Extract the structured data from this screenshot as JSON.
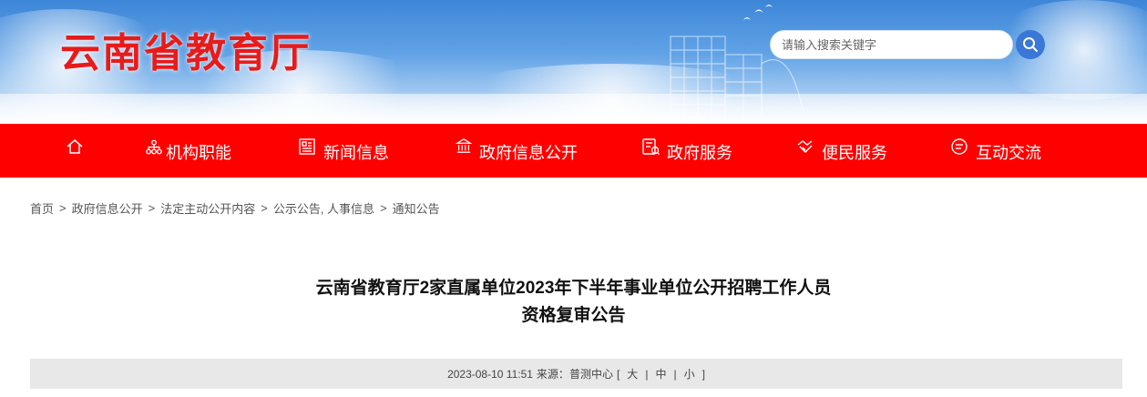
{
  "header": {
    "site_title": "云南省教育厅",
    "search_placeholder": "请输入搜索关键字",
    "search_icon": "search-icon"
  },
  "nav": {
    "items": [
      {
        "label": "",
        "icon": "home-icon"
      },
      {
        "label": "机构职能",
        "icon": "org-chart-icon"
      },
      {
        "label": "新闻信息",
        "icon": "newspaper-icon"
      },
      {
        "label": "政府信息公开",
        "icon": "government-building-icon"
      },
      {
        "label": "政府服务",
        "icon": "service-icon"
      },
      {
        "label": "便民服务",
        "icon": "handshake-icon"
      },
      {
        "label": "互动交流",
        "icon": "chat-icon"
      }
    ]
  },
  "breadcrumb": {
    "items": [
      "首页",
      "政府信息公开",
      "法定主动公开内容",
      "公示公告, 人事信息",
      "通知公告"
    ],
    "separator": ">"
  },
  "article": {
    "title_line1": "云南省教育厅2家直属单位2023年下半年事业单位公开招聘工作人员",
    "title_line2": "资格复审公告",
    "meta": {
      "datetime": "2023-08-10 11:51",
      "source_label": "来源：",
      "source": "普测中心",
      "bracket_open": "[",
      "font_large": "大",
      "font_medium": "中",
      "font_small": "小",
      "divider": "|",
      "bracket_close": "]"
    }
  },
  "colors": {
    "nav_bg": "#ff0000",
    "title_red": "#e81b1b",
    "search_btn": "#3a77d6",
    "meta_bg": "#e8e8e8"
  }
}
